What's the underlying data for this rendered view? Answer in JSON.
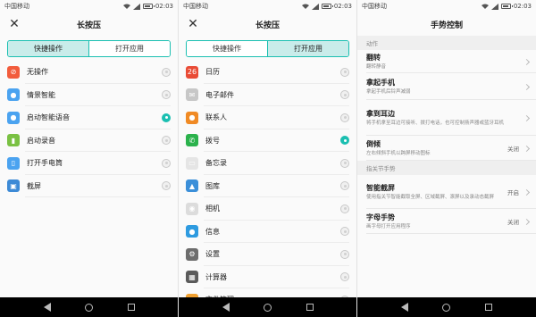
{
  "status": {
    "carrier": "中国移动",
    "time": "02:03"
  },
  "panel1": {
    "title": "长按压",
    "tabs": [
      "快捷操作",
      "打开应用"
    ],
    "active_tab": 0,
    "items": [
      {
        "label": "无操作",
        "icon": "no-action-icon",
        "color": "#f25c3c",
        "glyph": "⊘",
        "selected": false
      },
      {
        "label": "情景智能",
        "icon": "bulb-icon",
        "color": "#4ba3f0",
        "glyph": "●",
        "selected": false
      },
      {
        "label": "启动智能语音",
        "icon": "microphone-icon",
        "color": "#4ba3f0",
        "glyph": "●",
        "selected": true
      },
      {
        "label": "启动录音",
        "icon": "recorder-icon",
        "color": "#7ac143",
        "glyph": "▮",
        "selected": false
      },
      {
        "label": "打开手电筒",
        "icon": "flashlight-icon",
        "color": "#4ba3f0",
        "glyph": "▯",
        "selected": false
      },
      {
        "label": "截屏",
        "icon": "screenshot-icon",
        "color": "#3d8ad6",
        "glyph": "▣",
        "selected": false
      }
    ]
  },
  "panel2": {
    "title": "长按压",
    "tabs": [
      "快捷操作",
      "打开应用"
    ],
    "active_tab": 1,
    "items": [
      {
        "label": "日历",
        "icon": "calendar-icon",
        "color": "#e94b35",
        "glyph": "26",
        "selected": false
      },
      {
        "label": "电子邮件",
        "icon": "email-icon",
        "color": "#c7c7c7",
        "glyph": "✉",
        "selected": false
      },
      {
        "label": "联系人",
        "icon": "contacts-icon",
        "color": "#f08a24",
        "glyph": "●",
        "selected": false
      },
      {
        "label": "拨号",
        "icon": "phone-icon",
        "color": "#2bb24c",
        "glyph": "✆",
        "selected": true
      },
      {
        "label": "备忘录",
        "icon": "notes-icon",
        "color": "#e5e5e5",
        "glyph": "▭",
        "selected": false
      },
      {
        "label": "图库",
        "icon": "gallery-icon",
        "color": "#3b8fd9",
        "glyph": "▲",
        "selected": false
      },
      {
        "label": "相机",
        "icon": "camera-icon",
        "color": "#dcdcdc",
        "glyph": "◉",
        "selected": false
      },
      {
        "label": "信息",
        "icon": "messages-icon",
        "color": "#2e9be0",
        "glyph": "●",
        "selected": false
      },
      {
        "label": "设置",
        "icon": "settings-icon",
        "color": "#6d6d6d",
        "glyph": "⚙",
        "selected": false
      },
      {
        "label": "计算器",
        "icon": "calculator-icon",
        "color": "#5a5a5a",
        "glyph": "▦",
        "selected": false
      },
      {
        "label": "文件管理",
        "icon": "files-icon",
        "color": "#f0a030",
        "glyph": "▬",
        "selected": false
      }
    ]
  },
  "panel3": {
    "title": "手势控制",
    "sections": [
      {
        "header": "动作",
        "items": [
          {
            "title": "翻转",
            "subtitle": "翻转静音",
            "status": ""
          },
          {
            "title": "拿起手机",
            "subtitle": "拿起手机后铃声减弱",
            "status": ""
          },
          {
            "title": "拿到耳边",
            "subtitle": "将手机拿至耳边可接听、拨打电话，也可控制扬声器或蓝牙耳机",
            "status": ""
          },
          {
            "title": "倒倾",
            "subtitle": "左右倾斜手机以跨屏移动图标",
            "status": "关闭"
          }
        ]
      },
      {
        "header": "指关节手势",
        "items": [
          {
            "title": "智能截屏",
            "subtitle": "使用指关节智能截取全屏、区域截屏、滚屏以及录动态截屏",
            "status": "开启"
          },
          {
            "title": "字母手势",
            "subtitle": "画字母打开应用程序",
            "status": "关闭"
          }
        ]
      }
    ]
  }
}
